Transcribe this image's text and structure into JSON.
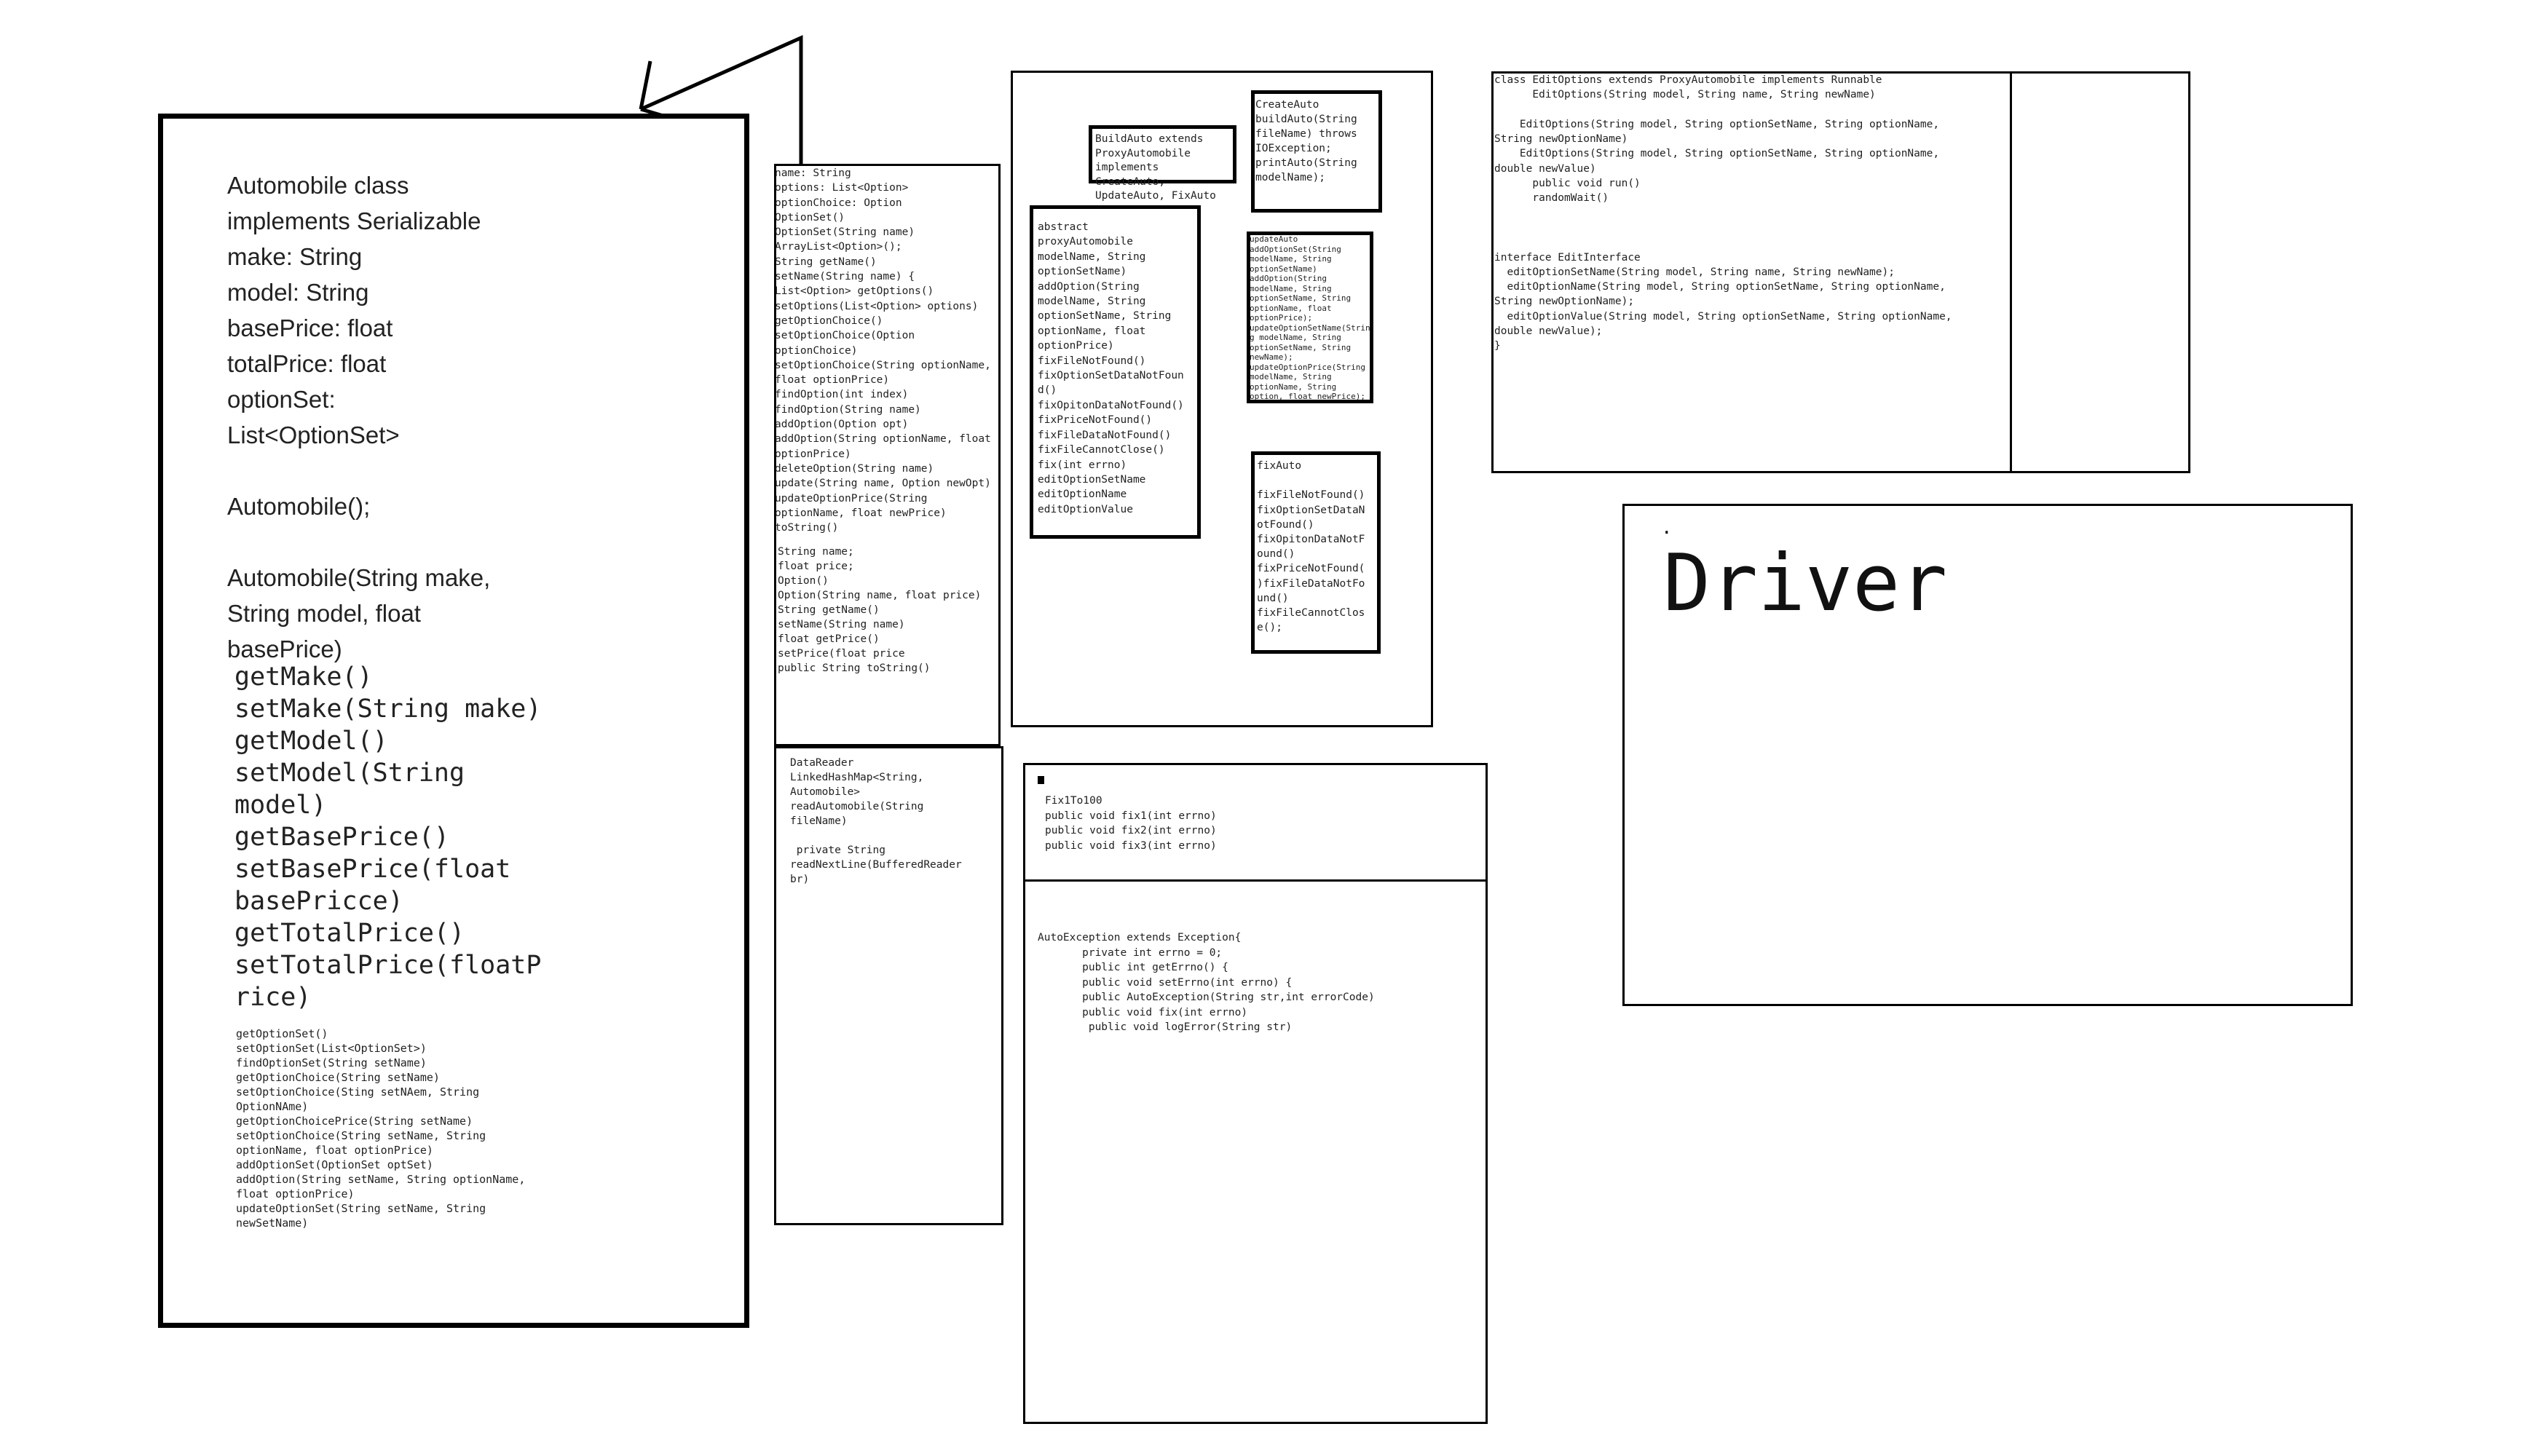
{
  "automobile_box": {
    "lines": [
      "Automobile class",
      "implements Serializable",
      "make: String",
      "model: String",
      "basePrice: float",
      "totalPrice: float",
      "optionSet:",
      "List<OptionSet>",
      "",
      "Automobile();",
      "",
      "Automobile(String make,",
      "String model, float",
      "basePrice)"
    ],
    "methods_large": [
      "getMake()",
      "setMake(String make)",
      "getModel()",
      "setModel(String",
      "model)",
      "getBasePrice()",
      "setBasePrice(float",
      "basePricce)",
      "getTotalPrice()",
      "setTotalPrice(floatP",
      "rice)"
    ],
    "methods_small": [
      "getOptionSet()",
      "setOptionSet(List<OptionSet>)",
      "findOptionSet(String setName)",
      "getOptionChoice(String setName)",
      "setOptionChoice(Sting setNAem, String",
      "OptionNAme)",
      "getOptionChoicePrice(String setName)",
      "setOptionChoice(String setName, String",
      "optionName, float optionPrice)",
      "addOptionSet(OptionSet optSet)",
      "addOption(String setName, String optionName,",
      "float optionPrice)",
      "updateOptionSet(String setName, String",
      "newSetName)"
    ]
  },
  "optionset_box": {
    "lines": [
      "name: String",
      "options: List<Option>",
      "optionChoice: Option",
      "OptionSet()",
      "OptionSet(String name)",
      "ArrayList<Option>();",
      "String getName()",
      "setName(String name) {",
      "List<Option> getOptions()",
      "setOptions(List<Option> options)",
      "getOptionChoice()",
      "setOptionChoice(Option",
      "optionChoice)",
      "setOptionChoice(String optionName,",
      "float optionPrice)",
      "findOption(int index)",
      "findOption(String name)",
      "addOption(Option opt)",
      "addOption(String optionName, float",
      "optionPrice)",
      "deleteOption(String name)",
      "update(String name, Option newOpt)",
      "updateOptionPrice(String",
      "optionName, float newPrice)",
      "toString()"
    ],
    "option_lines": [
      "String name;",
      "float price;",
      "Option()",
      "Option(String name, float price)",
      "String getName()",
      "setName(String name)",
      "float getPrice()",
      "setPrice(float price",
      "public String toString()"
    ]
  },
  "datareader_box": {
    "lines": [
      "DataReader",
      "LinkedHashMap<String,",
      "Automobile>",
      "readAutomobile(String",
      "fileName)",
      "",
      " private String",
      "readNextLine(BufferedReader",
      "br)"
    ]
  },
  "adapter_group": {
    "buildauto_lines": [
      "BuildAuto extends",
      "ProxyAutomobile",
      "implements",
      "CreateAuto,",
      "UpdateAuto, FixAuto"
    ],
    "createauto_lines": [
      "CreateAuto",
      "buildAuto(String",
      "fileName) throws",
      "IOException;",
      "printAuto(String",
      "modelName);"
    ],
    "proxy_lines": [
      "abstract",
      "proxyAutomobile",
      "modelName, String",
      "optionSetName)",
      "addOption(String",
      "modelName, String",
      "optionSetName, String",
      "optionName, float",
      "optionPrice)",
      "fixFileNotFound()",
      "fixOptionSetDataNotFoun",
      "d()",
      "fixOpitonDataNotFound()",
      "fixPriceNotFound()",
      "fixFileDataNotFound()",
      "fixFileCannotClose()",
      "fix(int errno)",
      "editOptionSetName",
      "editOptionName",
      "editOptionValue"
    ],
    "updateauto_lines": [
      "updateAuto",
      "addOptionSet(String",
      "modelName, String",
      "optionSetName)",
      "addOption(String",
      "modelName, String",
      "optionSetName, String",
      "optionName, float",
      "optionPrice);",
      "updateOptionSetName(Strin",
      "g modelName, String",
      "optionSetName, String",
      "newName);",
      "updateOptionPrice(String",
      "modelName, String",
      "optionName, String",
      "option, float newPrice);"
    ],
    "fixauto_lines": [
      "fixAuto",
      "",
      "fixFileNotFound()",
      "fixOptionSetDataN",
      "otFound()",
      "fixOpitonDataNotF",
      "ound()",
      "fixPriceNotFound(",
      ")fixFileDataNotFo",
      "und()",
      "fixFileCannotClos",
      "e();"
    ]
  },
  "editoptions_box": {
    "lines": [
      "class EditOptions extends ProxyAutomobile implements Runnable",
      "      EditOptions(String model, String name, String newName)",
      "",
      "    EditOptions(String model, String optionSetName, String optionName,",
      "String newOptionName)",
      "    EditOptions(String model, String optionSetName, String optionName,",
      "double newValue)",
      "      public void run()",
      "      randomWait()",
      "",
      "",
      "",
      "interface EditInterface",
      "  editOptionSetName(String model, String name, String newName);",
      "  editOptionName(String model, String optionSetName, String optionName,",
      "String newOptionName);",
      "  editOptionValue(String model, String optionSetName, String optionName,",
      "double newValue);",
      "}"
    ]
  },
  "exception_box": {
    "top_lines": [
      "Fix1To100",
      "public void fix1(int errno)",
      "public void fix2(int errno)",
      "public void fix3(int errno)"
    ],
    "bottom_lines": [
      "AutoException extends Exception{",
      "       private int errno = 0;",
      "       public int getErrno() {",
      "       public void setErrno(int errno) {",
      "       public AutoException(String str,int errorCode)",
      "       public void fix(int errno)",
      "        public void logError(String str)"
    ]
  },
  "driver_box": {
    "title": "Driver",
    "dot": "."
  }
}
